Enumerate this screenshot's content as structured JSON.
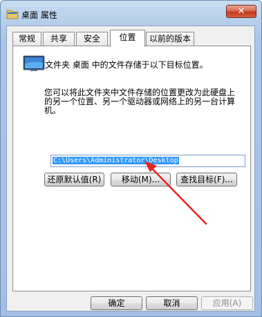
{
  "window": {
    "title": "桌面 属性",
    "close_label": "✕"
  },
  "tabs": [
    {
      "label": "常规",
      "active": false
    },
    {
      "label": "共享",
      "active": false
    },
    {
      "label": "安全",
      "active": false
    },
    {
      "label": "位置",
      "active": true
    },
    {
      "label": "以前的版本",
      "active": false
    }
  ],
  "location": {
    "description": "文件夹 桌面 中的文件存储于以下目标位置。",
    "explanation_lines": [
      "您可以将此文件夹中文件存储的位置更改为此硬盘上",
      "的另一个位置、另一个驱动器或网络上的另一台计算",
      "机。"
    ],
    "path_value": "C:\\Users\\Administrator\\Desktop",
    "restore_default_label": "还原默认值(R)",
    "move_label": "移动(M)...",
    "find_target_label": "查找目标(F)..."
  },
  "footer": {
    "ok_label": "确定",
    "cancel_label": "取消",
    "apply_label": "应用(A)",
    "apply_enabled": false
  },
  "annotation": {
    "arrow_color": "#e8231f"
  }
}
